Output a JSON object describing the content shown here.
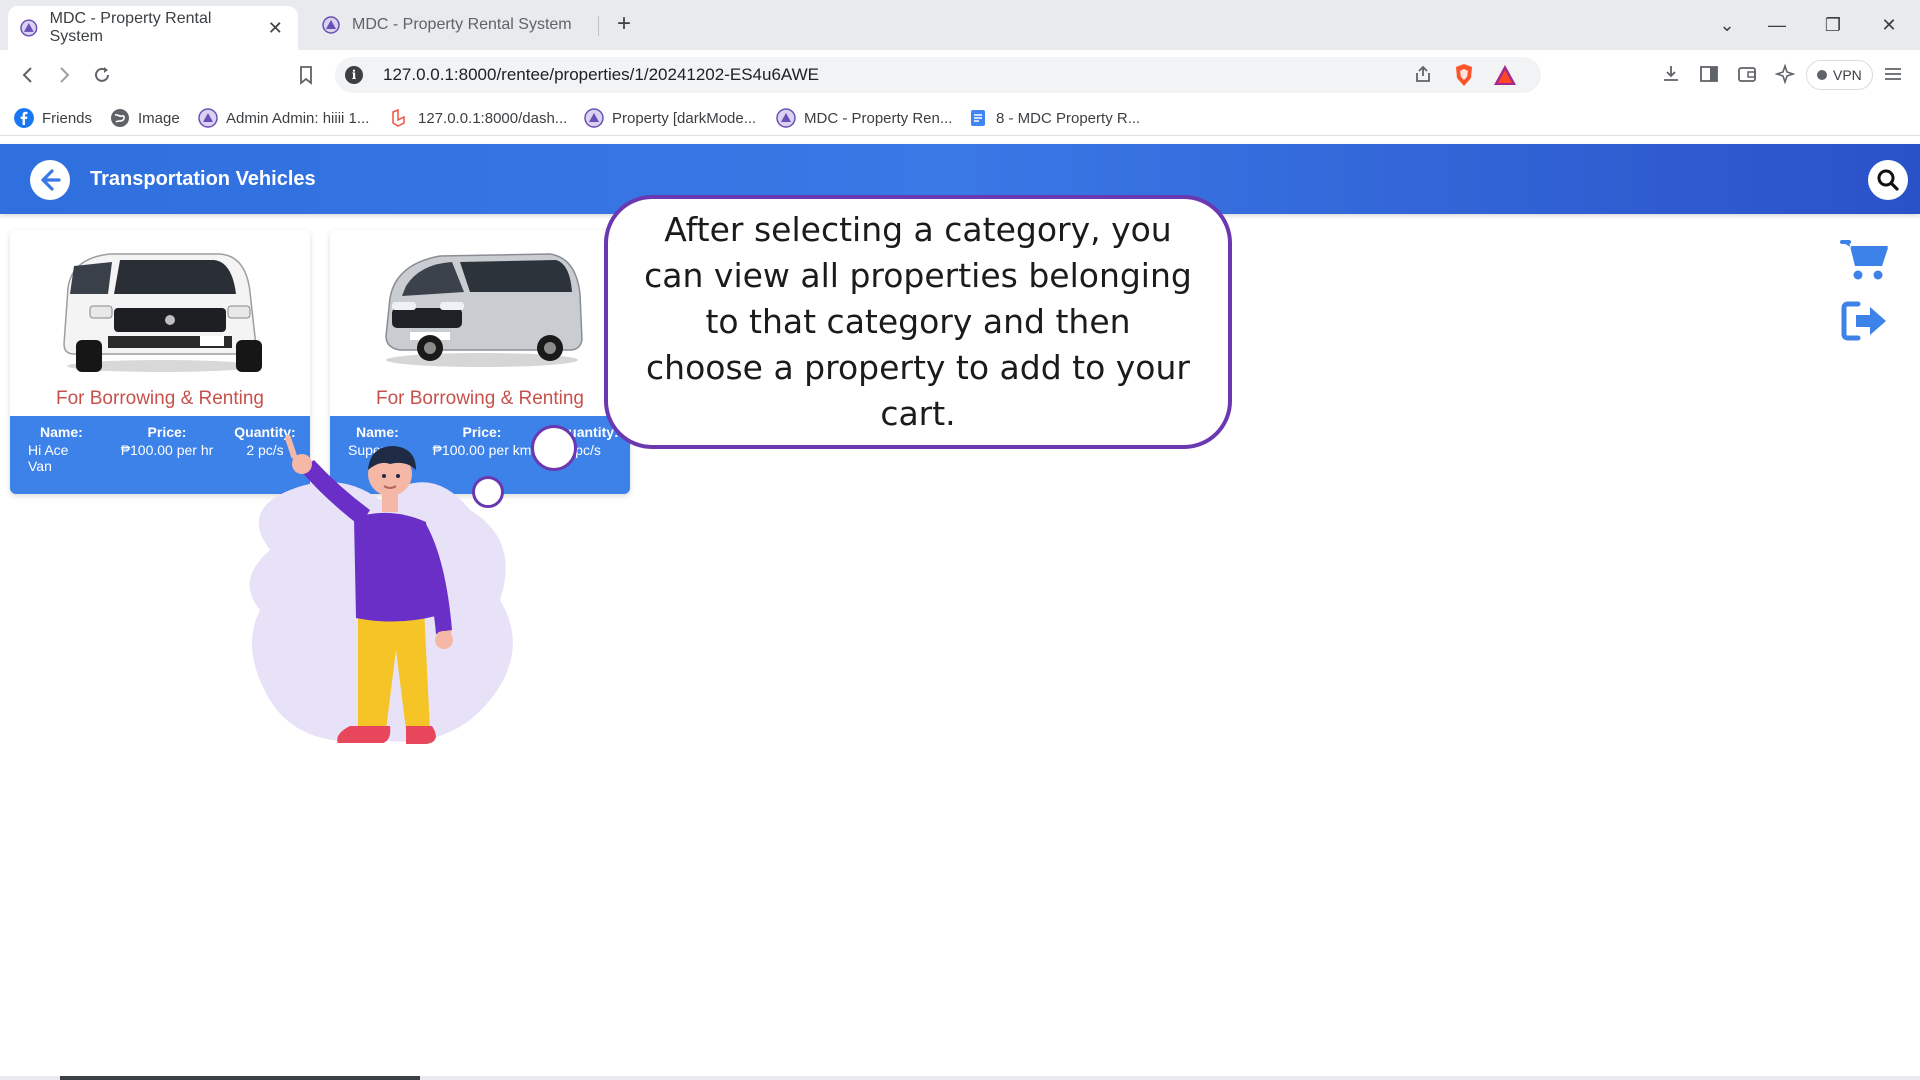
{
  "browser": {
    "tabs": [
      {
        "title": "MDC - Property Rental System",
        "active": true
      },
      {
        "title": "MDC - Property Rental System",
        "active": false
      }
    ],
    "new_tab_symbol": "+",
    "close_symbol": "✕",
    "window_controls": {
      "dropdown": "⌄",
      "minimize": "—",
      "restore": "❐",
      "close": "✕"
    },
    "address": "127.0.0.1:8000/rentee/properties/1/20241202-ES4u6AWE",
    "vpn_label": "VPN",
    "bookmarks": [
      {
        "label": "Friends",
        "icon": "facebook-icon"
      },
      {
        "label": "Image",
        "icon": "globe-icon"
      },
      {
        "label": "Admin Admin: hiiii 1...",
        "icon": "mdc-logo-icon"
      },
      {
        "label": "127.0.0.1:8000/dash...",
        "icon": "laravel-icon"
      },
      {
        "label": "Property [darkMode...",
        "icon": "mdc-logo-icon"
      },
      {
        "label": "MDC - Property Ren...",
        "icon": "mdc-logo-icon"
      },
      {
        "label": "8 - MDC Property R...",
        "icon": "docs-icon"
      }
    ]
  },
  "app": {
    "title": "Transportation Vehicles",
    "accent": "#3c82e8",
    "tag_color": "#c5524c",
    "cards": [
      {
        "tag": "For Borrowing & Renting",
        "name_label": "Name:",
        "name": "Hi Ace Van",
        "price_label": "Price:",
        "price": "₱100.00 per hr",
        "qty_label": "Quantity:",
        "qty": "2 pc/s"
      },
      {
        "tag": "For Borrowing & Renting",
        "name_label": "Name:",
        "name": "Super",
        "price_label": "Price:",
        "price": "₱100.00 per km",
        "qty_label": "Quantity:",
        "qty": "pc/s"
      }
    ]
  },
  "tutorial": {
    "text": "After selecting a category, you can view all properties belonging to that category and then choose a property to add to your cart.",
    "border_color": "#6a38b0"
  }
}
